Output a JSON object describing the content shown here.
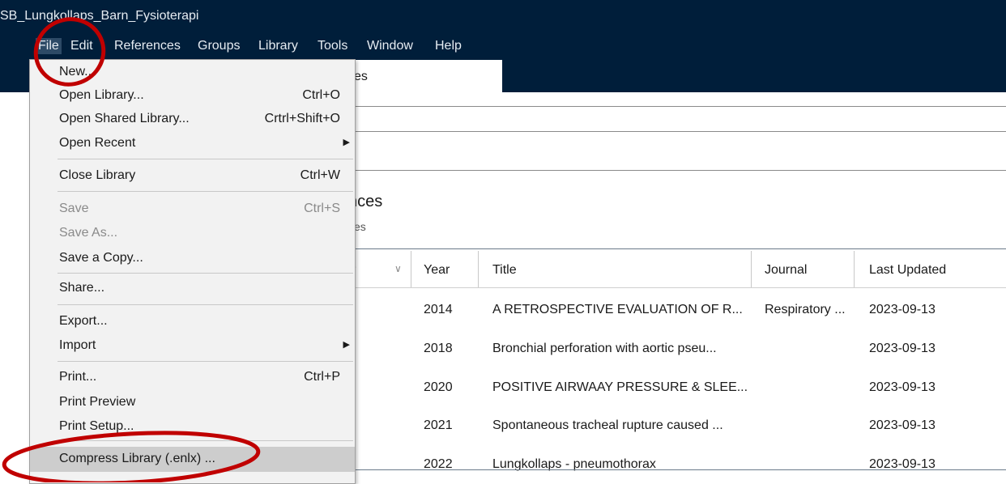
{
  "window": {
    "title": "SB_Lungkollaps_Barn_Fysioterapi"
  },
  "menubar": [
    "File",
    "Edit",
    "References",
    "Groups",
    "Library",
    "Tools",
    "Window",
    "Help"
  ],
  "tab": {
    "label_partial": "es"
  },
  "section": {
    "title_partial": "nces",
    "subtitle_partial": "ces"
  },
  "file_menu": {
    "new": {
      "label": "New..."
    },
    "open_library": {
      "label": "Open Library...",
      "shortcut": "Ctrl+O"
    },
    "open_shared_library": {
      "label": "Open Shared Library...",
      "shortcut": "Crtrl+Shift+O"
    },
    "open_recent": {
      "label": "Open Recent"
    },
    "close_library": {
      "label": "Close Library",
      "shortcut": "Ctrl+W"
    },
    "save": {
      "label": "Save",
      "shortcut": "Ctrl+S"
    },
    "save_as": {
      "label": "Save As..."
    },
    "save_copy": {
      "label": "Save a Copy..."
    },
    "share": {
      "label": "Share..."
    },
    "export": {
      "label": "Export..."
    },
    "import": {
      "label": "Import"
    },
    "print": {
      "label": "Print...",
      "shortcut": "Ctrl+P"
    },
    "print_preview": {
      "label": "Print Preview"
    },
    "print_setup": {
      "label": "Print Setup..."
    },
    "compress_library": {
      "label": "Compress Library (.enlx) ..."
    }
  },
  "table": {
    "columns": {
      "author_partial": "r",
      "year": "Year",
      "title": "Title",
      "journal": "Journal",
      "last_updated": "Last Updated"
    },
    "rows": [
      {
        "year": "2014",
        "title": "A RETROSPECTIVE EVALUATION OF R...",
        "journal": "Respiratory ...",
        "updated": "2023-09-13"
      },
      {
        "year": "2018",
        "title": "Bronchial perforation with aortic pseu...",
        "journal": "",
        "updated": "2023-09-13"
      },
      {
        "year": "2020",
        "title": "POSITIVE AIRWAAY PRESSURE & SLEE...",
        "journal": "",
        "updated": "2023-09-13"
      },
      {
        "year": "2021",
        "title": "Spontaneous tracheal rupture caused ...",
        "journal": "",
        "updated": "2023-09-13"
      },
      {
        "year": "2022",
        "title": "Lungkollaps - pneumothorax",
        "journal": "",
        "updated": "2023-09-13"
      }
    ]
  },
  "colors": {
    "titlebar": "#001e3a",
    "menu_bg": "#f2f2f2",
    "highlight": "#cdcdcd",
    "annotation": "#c00000"
  }
}
